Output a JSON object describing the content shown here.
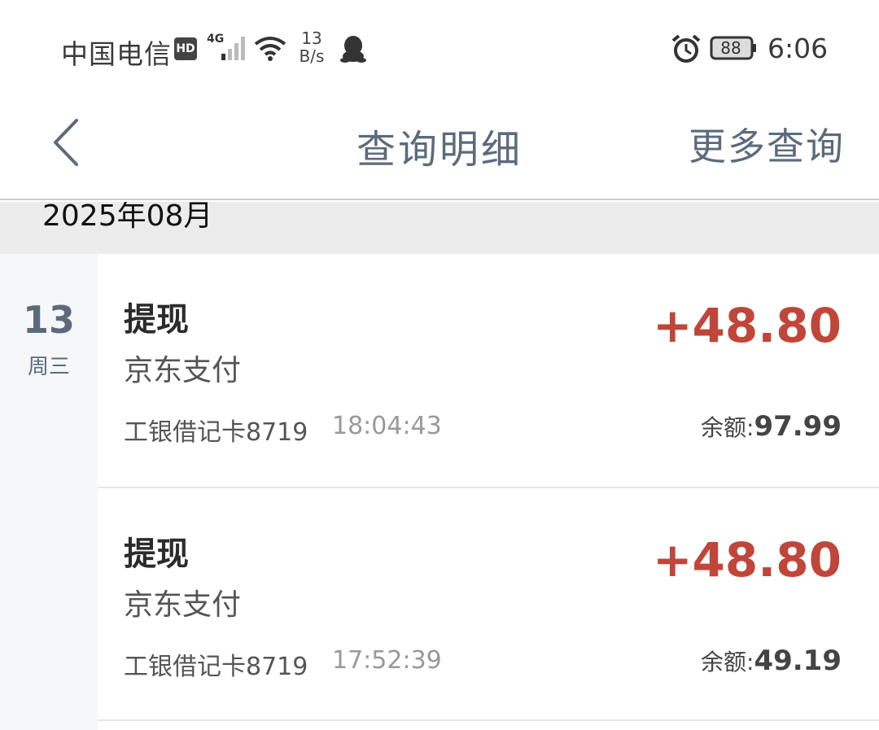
{
  "status_bar": {
    "carrier": "中国电信",
    "hd": "HD",
    "network": "4G",
    "speed_value": "13",
    "speed_unit": "B/s",
    "battery": "88",
    "time": "6:06"
  },
  "nav": {
    "title": "查询明细",
    "more": "更多查询"
  },
  "month": "2025年08月",
  "date_group": {
    "day": "13",
    "weekday": "周三"
  },
  "transactions": [
    {
      "type": "提现",
      "merchant": "京东支付",
      "card": "工银借记卡8719",
      "time": "18:04:43",
      "amount": "+48.80",
      "balance_label": "余额:",
      "balance": "97.99"
    },
    {
      "type": "提现",
      "merchant": "京东支付",
      "card": "工银借记卡8719",
      "time": "17:52:39",
      "amount": "+48.80",
      "balance_label": "余额:",
      "balance": "49.19"
    }
  ],
  "colors": {
    "amount": "#c0463a",
    "nav_text": "#5b6b7c"
  }
}
